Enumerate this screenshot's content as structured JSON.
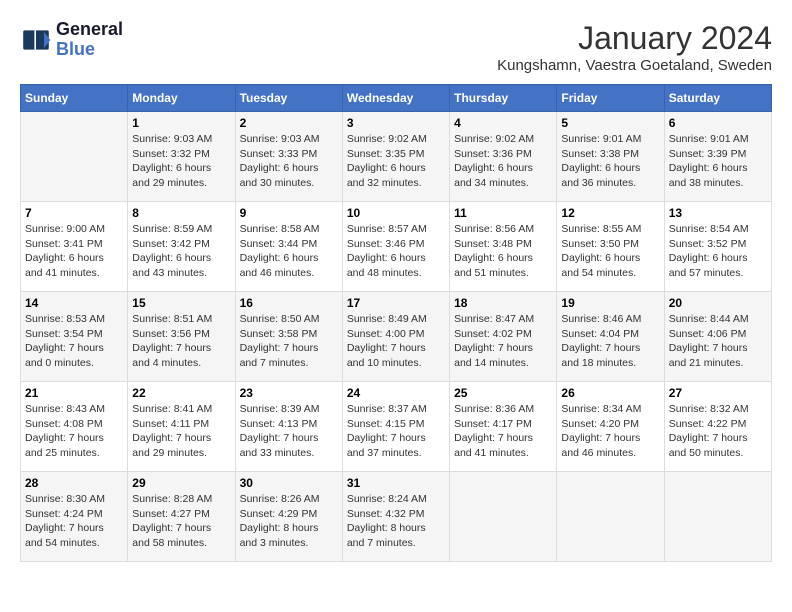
{
  "header": {
    "logo_line1": "General",
    "logo_line2": "Blue",
    "month_year": "January 2024",
    "location": "Kungshamn, Vaestra Goetaland, Sweden"
  },
  "days_of_week": [
    "Sunday",
    "Monday",
    "Tuesday",
    "Wednesday",
    "Thursday",
    "Friday",
    "Saturday"
  ],
  "weeks": [
    [
      {
        "day": "",
        "info": ""
      },
      {
        "day": "1",
        "info": "Sunrise: 9:03 AM\nSunset: 3:32 PM\nDaylight: 6 hours\nand 29 minutes."
      },
      {
        "day": "2",
        "info": "Sunrise: 9:03 AM\nSunset: 3:33 PM\nDaylight: 6 hours\nand 30 minutes."
      },
      {
        "day": "3",
        "info": "Sunrise: 9:02 AM\nSunset: 3:35 PM\nDaylight: 6 hours\nand 32 minutes."
      },
      {
        "day": "4",
        "info": "Sunrise: 9:02 AM\nSunset: 3:36 PM\nDaylight: 6 hours\nand 34 minutes."
      },
      {
        "day": "5",
        "info": "Sunrise: 9:01 AM\nSunset: 3:38 PM\nDaylight: 6 hours\nand 36 minutes."
      },
      {
        "day": "6",
        "info": "Sunrise: 9:01 AM\nSunset: 3:39 PM\nDaylight: 6 hours\nand 38 minutes."
      }
    ],
    [
      {
        "day": "7",
        "info": "Sunrise: 9:00 AM\nSunset: 3:41 PM\nDaylight: 6 hours\nand 41 minutes."
      },
      {
        "day": "8",
        "info": "Sunrise: 8:59 AM\nSunset: 3:42 PM\nDaylight: 6 hours\nand 43 minutes."
      },
      {
        "day": "9",
        "info": "Sunrise: 8:58 AM\nSunset: 3:44 PM\nDaylight: 6 hours\nand 46 minutes."
      },
      {
        "day": "10",
        "info": "Sunrise: 8:57 AM\nSunset: 3:46 PM\nDaylight: 6 hours\nand 48 minutes."
      },
      {
        "day": "11",
        "info": "Sunrise: 8:56 AM\nSunset: 3:48 PM\nDaylight: 6 hours\nand 51 minutes."
      },
      {
        "day": "12",
        "info": "Sunrise: 8:55 AM\nSunset: 3:50 PM\nDaylight: 6 hours\nand 54 minutes."
      },
      {
        "day": "13",
        "info": "Sunrise: 8:54 AM\nSunset: 3:52 PM\nDaylight: 6 hours\nand 57 minutes."
      }
    ],
    [
      {
        "day": "14",
        "info": "Sunrise: 8:53 AM\nSunset: 3:54 PM\nDaylight: 7 hours\nand 0 minutes."
      },
      {
        "day": "15",
        "info": "Sunrise: 8:51 AM\nSunset: 3:56 PM\nDaylight: 7 hours\nand 4 minutes."
      },
      {
        "day": "16",
        "info": "Sunrise: 8:50 AM\nSunset: 3:58 PM\nDaylight: 7 hours\nand 7 minutes."
      },
      {
        "day": "17",
        "info": "Sunrise: 8:49 AM\nSunset: 4:00 PM\nDaylight: 7 hours\nand 10 minutes."
      },
      {
        "day": "18",
        "info": "Sunrise: 8:47 AM\nSunset: 4:02 PM\nDaylight: 7 hours\nand 14 minutes."
      },
      {
        "day": "19",
        "info": "Sunrise: 8:46 AM\nSunset: 4:04 PM\nDaylight: 7 hours\nand 18 minutes."
      },
      {
        "day": "20",
        "info": "Sunrise: 8:44 AM\nSunset: 4:06 PM\nDaylight: 7 hours\nand 21 minutes."
      }
    ],
    [
      {
        "day": "21",
        "info": "Sunrise: 8:43 AM\nSunset: 4:08 PM\nDaylight: 7 hours\nand 25 minutes."
      },
      {
        "day": "22",
        "info": "Sunrise: 8:41 AM\nSunset: 4:11 PM\nDaylight: 7 hours\nand 29 minutes."
      },
      {
        "day": "23",
        "info": "Sunrise: 8:39 AM\nSunset: 4:13 PM\nDaylight: 7 hours\nand 33 minutes."
      },
      {
        "day": "24",
        "info": "Sunrise: 8:37 AM\nSunset: 4:15 PM\nDaylight: 7 hours\nand 37 minutes."
      },
      {
        "day": "25",
        "info": "Sunrise: 8:36 AM\nSunset: 4:17 PM\nDaylight: 7 hours\nand 41 minutes."
      },
      {
        "day": "26",
        "info": "Sunrise: 8:34 AM\nSunset: 4:20 PM\nDaylight: 7 hours\nand 46 minutes."
      },
      {
        "day": "27",
        "info": "Sunrise: 8:32 AM\nSunset: 4:22 PM\nDaylight: 7 hours\nand 50 minutes."
      }
    ],
    [
      {
        "day": "28",
        "info": "Sunrise: 8:30 AM\nSunset: 4:24 PM\nDaylight: 7 hours\nand 54 minutes."
      },
      {
        "day": "29",
        "info": "Sunrise: 8:28 AM\nSunset: 4:27 PM\nDaylight: 7 hours\nand 58 minutes."
      },
      {
        "day": "30",
        "info": "Sunrise: 8:26 AM\nSunset: 4:29 PM\nDaylight: 8 hours\nand 3 minutes."
      },
      {
        "day": "31",
        "info": "Sunrise: 8:24 AM\nSunset: 4:32 PM\nDaylight: 8 hours\nand 7 minutes."
      },
      {
        "day": "",
        "info": ""
      },
      {
        "day": "",
        "info": ""
      },
      {
        "day": "",
        "info": ""
      }
    ]
  ]
}
